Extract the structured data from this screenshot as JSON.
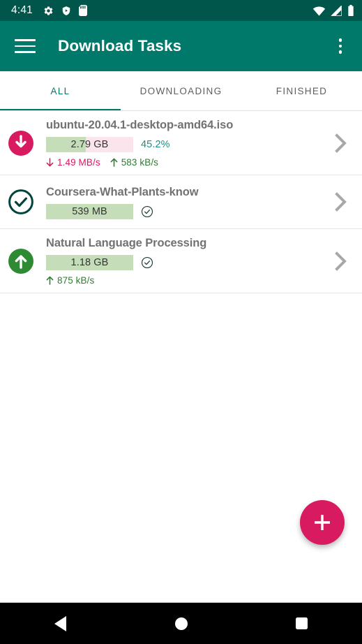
{
  "status_bar": {
    "clock": "4:41",
    "left_icons": [
      "gear-icon",
      "shield-play-icon",
      "sd-card-icon"
    ],
    "right_icons": [
      "wifi-icon",
      "cellular-signal-icon",
      "battery-icon"
    ],
    "background_color": "#00564a"
  },
  "toolbar": {
    "title": "Download Tasks",
    "menu_icon": "hamburger-menu-icon",
    "overflow_icon": "overflow-menu-icon",
    "background_color": "#00796b"
  },
  "tabs": [
    {
      "label": "ALL",
      "active": true
    },
    {
      "label": "DOWNLOADING",
      "active": false
    },
    {
      "label": "FINISHED",
      "active": false
    }
  ],
  "accent_colors": {
    "primary": "#00796b",
    "accent_pink": "#d81b60",
    "green": "#2e7d32",
    "progress_fill": "#c5ddb9",
    "progress_track": "#fce4ec",
    "percent_text": "#1a8f84"
  },
  "tasks": [
    {
      "status_icon": "download-circle-icon",
      "title": "ubuntu-20.04.1-desktop-amd64.iso",
      "size": "2.79 GB",
      "percent_label": "45.2%",
      "percent_value": 45.2,
      "completed": false,
      "download_speed": "1.49 MB/s",
      "upload_speed": "583 kB/s",
      "chevron_icon": "chevron-right-icon"
    },
    {
      "status_icon": "check-circle-outline-icon",
      "title": "Coursera-What-Plants-know",
      "size": "539 MB",
      "percent_label": "",
      "percent_value": 100,
      "completed": true,
      "download_speed": "",
      "upload_speed": "",
      "chevron_icon": "chevron-right-icon"
    },
    {
      "status_icon": "upload-circle-icon",
      "title": "Natural Language Processing",
      "size": "1.18 GB",
      "percent_label": "",
      "percent_value": 100,
      "completed": true,
      "download_speed": "",
      "upload_speed": "875 kB/s",
      "chevron_icon": "chevron-right-icon"
    }
  ],
  "fab": {
    "icon": "plus-icon",
    "color": "#d81b60"
  },
  "nav_bar": {
    "back": "back-triangle-icon",
    "home": "home-circle-icon",
    "recents": "recents-square-icon"
  }
}
